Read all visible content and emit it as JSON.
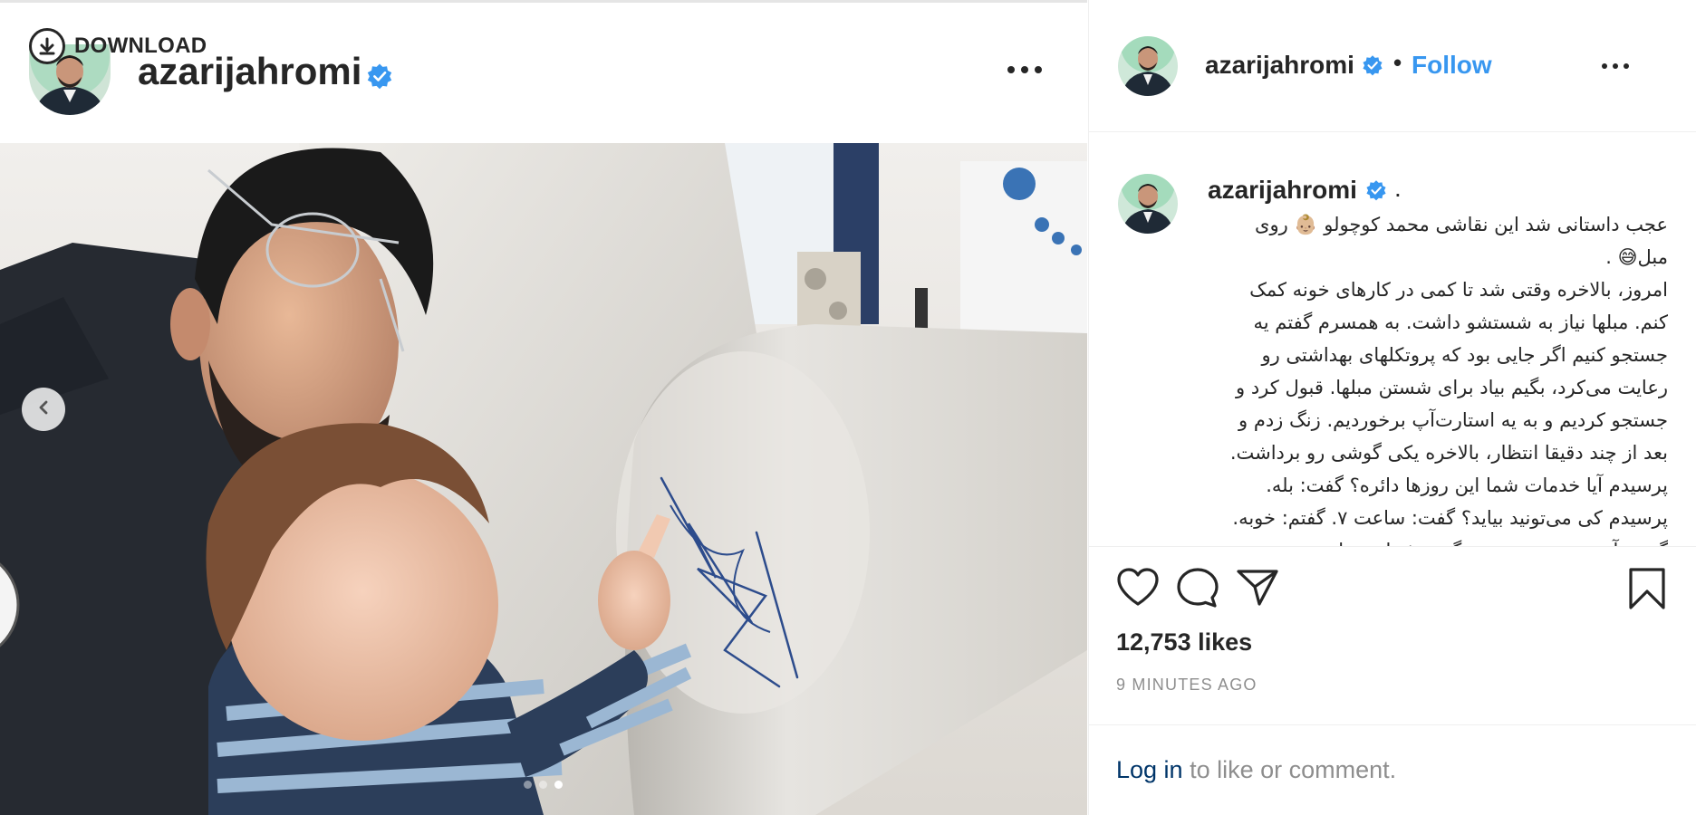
{
  "post": {
    "username": "azarijahromi",
    "verified": true,
    "follow_label": "Follow",
    "separator": "•",
    "more_label": "More options"
  },
  "download": {
    "label": "DOWNLOAD"
  },
  "carousel": {
    "total": 3,
    "active_index": 2
  },
  "caption": {
    "username": "azarijahromi",
    "trailing": ".",
    "lines": [
      "عجب داستانی شد این نقاشی محمد کوچولو 👶🏼 روی",
      "مبل😅 .",
      "امروز، بالاخره وقتی شد تا کمی در کارهای خونه کمک",
      "کنم. مبلها نیاز به شستشو داشت. به همسرم گفتم یه",
      "جستجو کنیم اگر جایی بود که پروتکلهای بهداشتی رو",
      "رعایت می‌کرد، بگیم بیاد برای شستن مبلها. قبول کرد و",
      "جستجو کردیم و به یه استارت‌آپ برخوردیم. زنگ زدم و",
      "بعد از چند دقیقا انتظار، بالاخره یکی گوشی رو برداشت.",
      "پرسیدم آیا خدمات شما این روزها دائره؟ گفت: بله.",
      "پرسیدم کی می‌تونید بیاید؟ گفت: ساعت ۷. گفتم: خوبه.",
      "گفتم: آدرس رو بنویسید و گفتم شماره تماس..."
    ]
  },
  "stats": {
    "likes": "12,753 likes",
    "time_ago": "9 MINUTES AGO"
  },
  "login": {
    "link": "Log in",
    "rest": " to like or comment."
  },
  "icons": {
    "download": "download-icon",
    "like": "heart-icon",
    "comment": "comment-icon",
    "share": "share-icon",
    "save": "bookmark-icon",
    "prev": "chevron-left-icon",
    "verified": "verified-badge-icon"
  },
  "colors": {
    "accent": "#3897f0",
    "verified": "#3897f0",
    "text": "#262626",
    "muted": "#8e8e8e",
    "link": "#003569"
  }
}
